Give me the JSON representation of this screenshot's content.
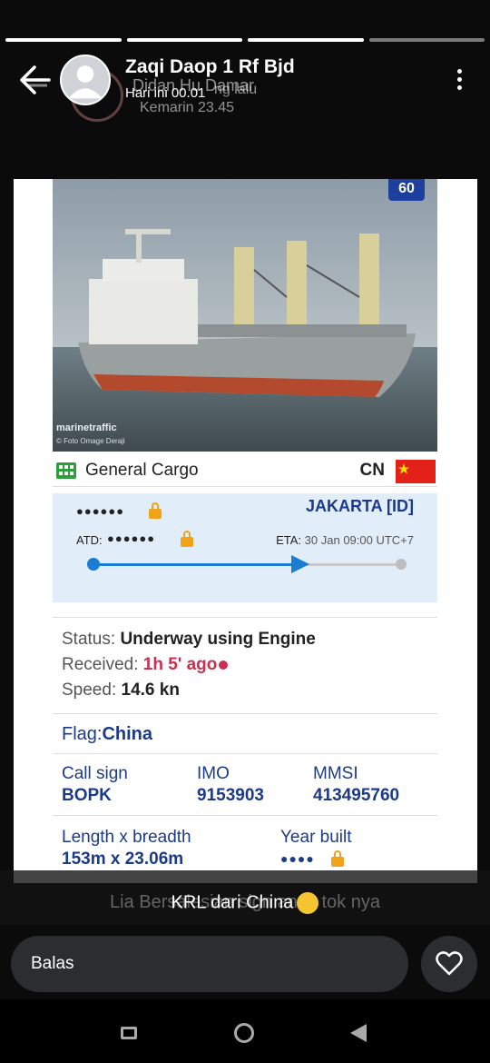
{
  "story": {
    "author": "Zaqi Daop 1 Rf Bjd",
    "timestamp": "Hari ini 00.01",
    "ghost_name": "Didan Hu Damar",
    "ghost_time_ago": "ng lalu",
    "ghost_timestamp": "Kemarin 23.45",
    "progress_segments": 4
  },
  "vessel": {
    "badge": "60",
    "photo_credit": "marinetraffic",
    "photo_subcredit": "© Foto Omage Deraji",
    "type": "General Cargo",
    "country_code": "CN",
    "name_masked": "●●●●●●",
    "destination": "JAKARTA [ID]",
    "atd_label": "ATD:",
    "atd_masked": "●●●●●●",
    "eta_label": "ETA:",
    "eta_value": "30 Jan 09:00 UTC+7",
    "route_progress": 0.68,
    "status_label": "Status:",
    "status_value": "Underway using Engine",
    "received_label": "Received:",
    "received_value": "1h 5' ago",
    "speed_label": "Speed:",
    "speed_value": "14.6 kn",
    "flag_label": "Flag:",
    "flag_value": "China",
    "callsign_label": "Call sign",
    "callsign_value": "BOPK",
    "imo_label": "IMO",
    "imo_value": "9153903",
    "mmsi_label": "MMSI",
    "mmsi_value": "413495760",
    "dims_label": "Length x breadth",
    "dims_value": "153m x 23.06m",
    "year_label": "Year built",
    "year_masked": "●●●●"
  },
  "caption": {
    "text": "KRL dari China",
    "ghost_text": "Lia Bersalesian sign anak tok nya",
    "emoji": "face-with-steam-emoji"
  },
  "reply": {
    "placeholder": "Balas"
  },
  "colors": {
    "accent_blue": "#1a7dd1",
    "navy": "#1c3a8a",
    "lock_orange": "#f0a21b",
    "received_red": "#c9304f",
    "flag_red": "#e32119"
  }
}
